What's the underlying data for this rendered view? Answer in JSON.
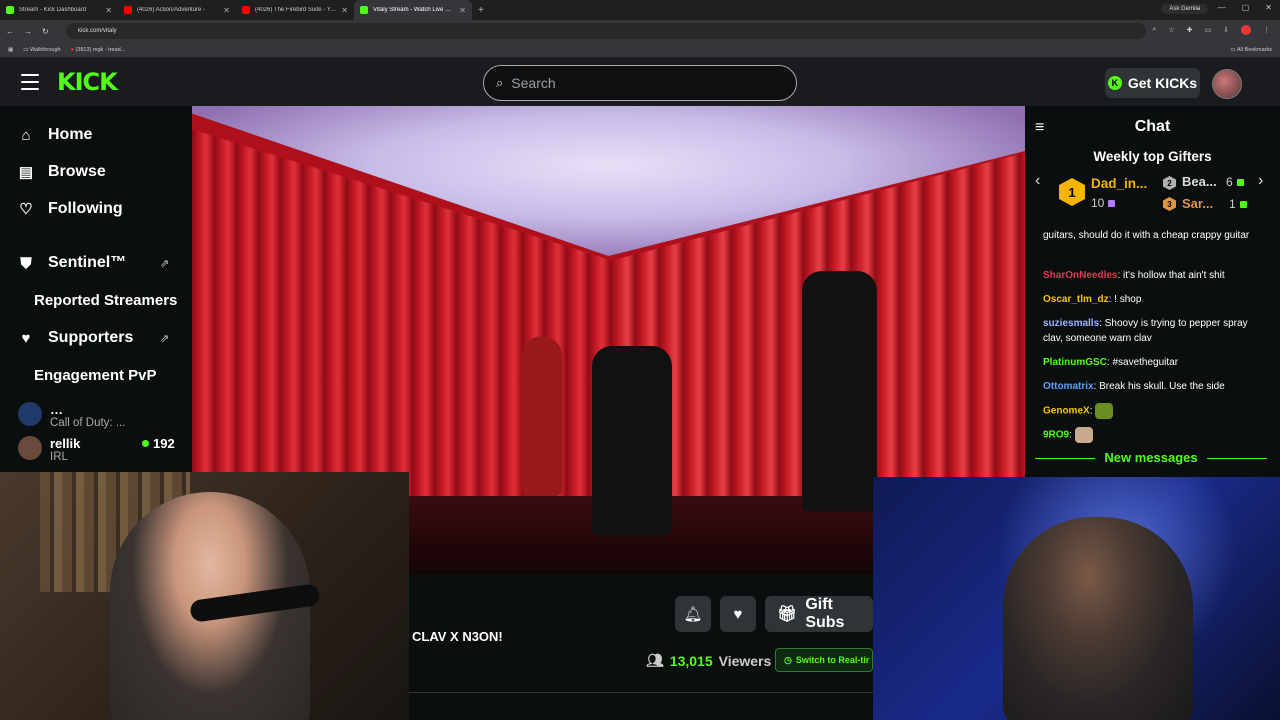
{
  "browser": {
    "tabs": [
      {
        "title": "Stream - Kick Dashboard",
        "color": "#53fc18"
      },
      {
        "title": "(4026) Action/Adventure -",
        "color": "#ff0000"
      },
      {
        "title": "(4026) The Firebird Suite - You",
        "color": "#ff0000"
      },
      {
        "title": "Vitaly Stream - Watch Live on K",
        "color": "#53fc18"
      }
    ],
    "new_tab": "+",
    "ask_gemini": "Ask Gemini",
    "url": "kick.com/vitaly",
    "bookmarks": [
      "Walkthrough",
      "(3813) mgk - tread..."
    ],
    "all_bookmarks": "All Bookmarks"
  },
  "header": {
    "logo": "KICK",
    "search_placeholder": "Search",
    "get_kicks": "Get KICKs",
    "kick_coin": "K"
  },
  "sidebar": {
    "nav": [
      {
        "label": "Home",
        "icon": "home-icon"
      },
      {
        "label": "Browse",
        "icon": "browse-icon"
      },
      {
        "label": "Following",
        "icon": "heart-icon"
      }
    ],
    "sentinel": "Sentinel™",
    "reported_streamers": "Reported Streamers",
    "supporters": "Supporters",
    "engagement": "Engagement PvP",
    "channels": [
      {
        "name": "…",
        "category": "Call of Duty: ...",
        "viewers": "…"
      },
      {
        "name": "rellik",
        "category": "IRL",
        "viewers": "192"
      }
    ]
  },
  "stream": {
    "title": "CLAV X N3ON!",
    "gift_subs": "Gift Subs",
    "viewers_count": "13,015",
    "viewers_label": "Viewers",
    "switch_realtime": "Switch to Real-tir"
  },
  "chat": {
    "title": "Chat",
    "gifters_title": "Weekly top Gifters",
    "gifters": [
      {
        "rank": "1",
        "name": "Dad_in...",
        "count": "10"
      },
      {
        "rank": "2",
        "name": "Bea...",
        "count": "6"
      },
      {
        "rank": "3",
        "name": "Sar...",
        "count": "1"
      }
    ],
    "messages": [
      {
        "user": "",
        "color": "#fff",
        "text": "guitars, should do it with a cheap crappy guitar"
      },
      {
        "user": "SharOnNeedles",
        "color": "#e23b4d",
        "text": ": it's hollow that ain't shit"
      },
      {
        "user": "Oscar_tlm_dz",
        "color": "#f5c400",
        "text": ": ! shop"
      },
      {
        "user": "suziesmalls",
        "color": "#9fb3ff",
        "text": ": Shoovy is trying to pepper spray clav, someone warn clav"
      },
      {
        "user": "PlatinumGSC",
        "color": "#53fc18",
        "text": ": #savetheguitar"
      },
      {
        "user": "Ottomatrix",
        "color": "#5aa0ff",
        "text": ": Break his skull. Use the side"
      },
      {
        "user": "GenomeX",
        "color": "#f5c400",
        "text": ":"
      },
      {
        "user": "9RO9",
        "color": "#53fc18",
        "text": ":"
      }
    ],
    "new_messages": "New messages"
  },
  "colors": {
    "accent": "#53fc18",
    "gold": "#f5b400"
  }
}
